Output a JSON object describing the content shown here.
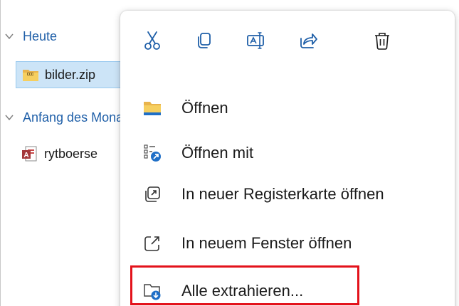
{
  "explorer": {
    "groups": [
      {
        "label": "Heute"
      },
      {
        "label": "Anfang des Monats"
      }
    ],
    "files": [
      {
        "name": "bilder.zip",
        "type": "zip-folder"
      },
      {
        "name": "rytboerse",
        "type": "access-database"
      }
    ]
  },
  "context_menu": {
    "toolbar": [
      {
        "name": "cut",
        "icon": "scissors-icon"
      },
      {
        "name": "copy",
        "icon": "copy-icon"
      },
      {
        "name": "rename",
        "icon": "rename-icon"
      },
      {
        "name": "share",
        "icon": "share-icon"
      },
      {
        "name": "delete",
        "icon": "trash-icon"
      }
    ],
    "items": [
      {
        "label": "Öffnen",
        "icon": "folder-icon"
      },
      {
        "label": "Öffnen mit",
        "icon": "open-with-icon"
      },
      {
        "label": "In neuer Registerkarte öffnen",
        "icon": "new-tab-icon"
      },
      {
        "label": "In neuem Fenster öffnen",
        "icon": "new-window-icon"
      },
      {
        "label": "Alle extrahieren...",
        "icon": "extract-all-icon"
      }
    ]
  },
  "colors": {
    "selection": "#cce4f7",
    "group_header": "#1f5fa8",
    "highlight": "#e3121b"
  }
}
